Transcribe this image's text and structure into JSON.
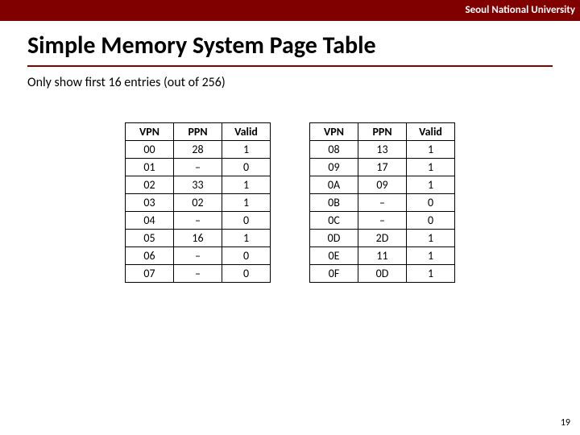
{
  "header": {
    "org": "Seoul National University"
  },
  "title": "Simple Memory System Page Table",
  "subtitle": "Only show first 16 entries (out of 256)",
  "columns": [
    "VPN",
    "PPN",
    "Valid"
  ],
  "left_rows": [
    {
      "vpn": "00",
      "ppn": "28",
      "valid": "1"
    },
    {
      "vpn": "01",
      "ppn": "–",
      "valid": "0"
    },
    {
      "vpn": "02",
      "ppn": "33",
      "valid": "1"
    },
    {
      "vpn": "03",
      "ppn": "02",
      "valid": "1"
    },
    {
      "vpn": "04",
      "ppn": "–",
      "valid": "0"
    },
    {
      "vpn": "05",
      "ppn": "16",
      "valid": "1"
    },
    {
      "vpn": "06",
      "ppn": "–",
      "valid": "0"
    },
    {
      "vpn": "07",
      "ppn": "–",
      "valid": "0"
    }
  ],
  "right_rows": [
    {
      "vpn": "08",
      "ppn": "13",
      "valid": "1"
    },
    {
      "vpn": "09",
      "ppn": "17",
      "valid": "1"
    },
    {
      "vpn": "0A",
      "ppn": "09",
      "valid": "1"
    },
    {
      "vpn": "0B",
      "ppn": "–",
      "valid": "0"
    },
    {
      "vpn": "0C",
      "ppn": "–",
      "valid": "0"
    },
    {
      "vpn": "0D",
      "ppn": "2D",
      "valid": "1"
    },
    {
      "vpn": "0E",
      "ppn": "11",
      "valid": "1"
    },
    {
      "vpn": "0F",
      "ppn": "0D",
      "valid": "1"
    }
  ],
  "page_number": "19"
}
